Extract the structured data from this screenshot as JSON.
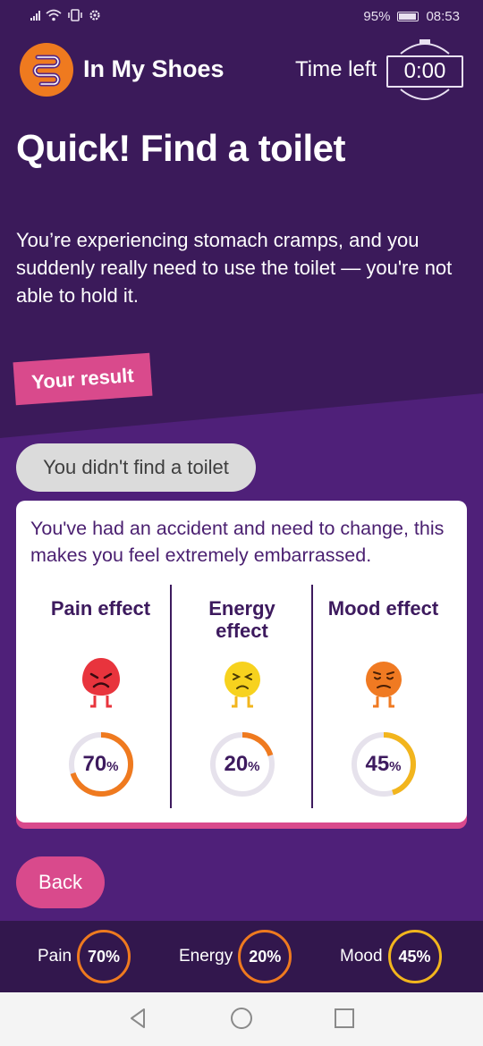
{
  "status_bar": {
    "battery": "95%",
    "time": "08:53",
    "icons": [
      "signal-icon",
      "wifi-icon",
      "vibrate-icon",
      "settings-icon",
      "battery-icon"
    ]
  },
  "header": {
    "brand": "In My Shoes",
    "time_left_label": "Time left",
    "timer": "0:00"
  },
  "scenario": {
    "title": "Quick! Find a toilet",
    "description": "You’re experiencing stomach cramps, and you suddenly really need to use the toilet — you're not able to hold it."
  },
  "result": {
    "tag": "Your result",
    "choice": "You didn't find a toilet",
    "message": "You've had an accident and need to change, this makes you feel extremely embarrassed.",
    "effects": [
      {
        "title": "Pain effect",
        "value": "70",
        "unit": "%",
        "fraction": 0.7,
        "color": "#ef7a1f"
      },
      {
        "title": "Energy effect",
        "value": "20",
        "unit": "%",
        "fraction": 0.2,
        "color": "#ef7a1f"
      },
      {
        "title": "Mood effect",
        "value": "45",
        "unit": "%",
        "fraction": 0.45,
        "color": "#f2b51d"
      }
    ]
  },
  "actions": {
    "back": "Back"
  },
  "footer": {
    "pain_label": "Pain",
    "pain_value": "70%",
    "energy_label": "Energy",
    "energy_value": "20%",
    "mood_label": "Mood",
    "mood_value": "45%"
  },
  "colors": {
    "background": "#3b1a5a",
    "accent_pink": "#d94a8c",
    "orange": "#ef7a1f",
    "yellow": "#f2b51d"
  }
}
